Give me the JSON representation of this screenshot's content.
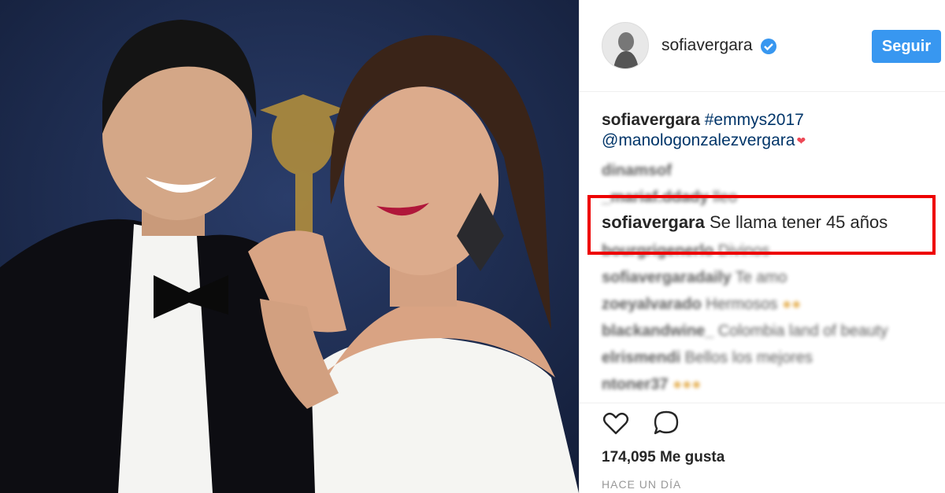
{
  "post": {
    "username": "sofiavergara",
    "follow_label": "Seguir",
    "caption_user": "sofiavergara",
    "caption_hashtag": "#emmys2017",
    "caption_mention": "@manologonzalezvergara",
    "highlighted_comment": {
      "user": "sofiavergara",
      "text": "Se llama tener 45 años"
    },
    "comments": [
      {
        "user": "dinamsof",
        "text": ""
      },
      {
        "user": "_mariaf.ddady",
        "text": "lleo"
      },
      {
        "user": "",
        "text": ""
      },
      {
        "user": "bourgrigenerlo",
        "text": "Divinos"
      },
      {
        "user": "sofiavergaradaily",
        "text": "Te amo"
      },
      {
        "user": "zoeyalvarado",
        "text": "Hermosos"
      },
      {
        "user": "blackandwine_",
        "text": "Colombia land of beauty"
      },
      {
        "user": "elrismendi",
        "text": "Bellos los mejores"
      },
      {
        "user": "ntoner37",
        "text": ""
      }
    ],
    "likes": "174,095 Me gusta",
    "time": "HACE UN DÍA"
  },
  "colors": {
    "accent": "#3897f0",
    "highlight": "#e00000",
    "link": "#003569"
  }
}
